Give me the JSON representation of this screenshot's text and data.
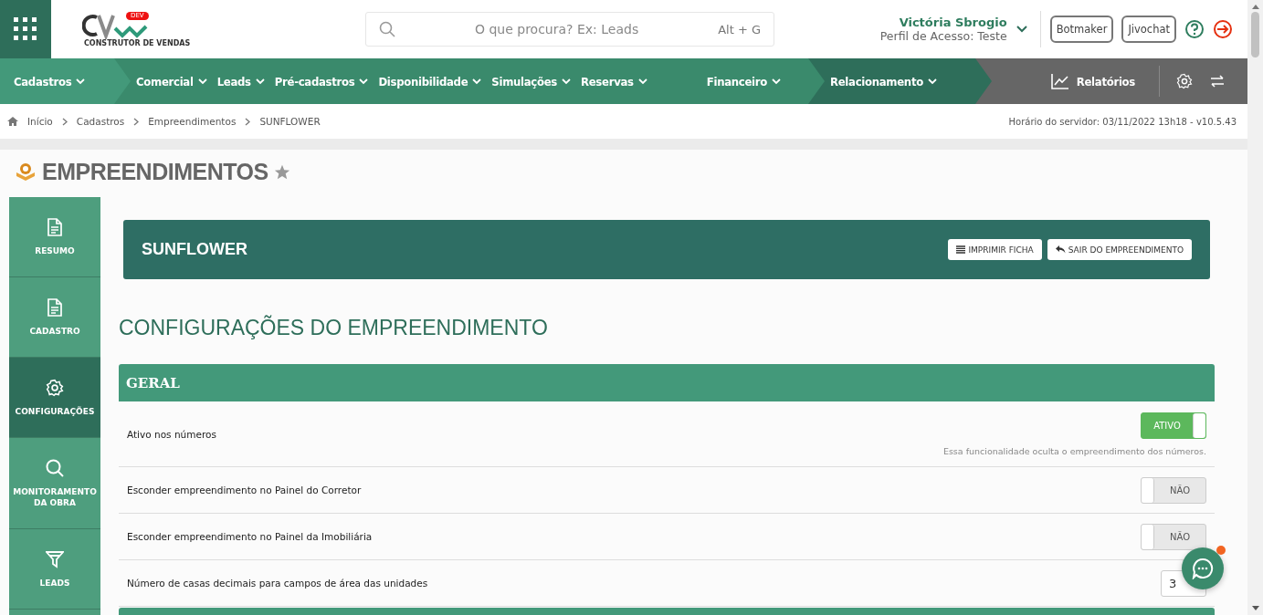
{
  "header": {
    "logo": {
      "text": "CONSTRUTOR DE VENDAS",
      "badge": "DEV"
    },
    "search": {
      "placeholder": "O que procura? Ex: Leads",
      "shortcut": "Alt + G"
    },
    "user": {
      "name": "Victória Sbrogio",
      "profile": "Perfil de Acesso: Teste"
    },
    "buttons": [
      "Botmaker",
      "Jivochat"
    ]
  },
  "nav": {
    "groups": [
      {
        "color": "#43997a",
        "items": [
          "Cadastros"
        ]
      },
      {
        "color": "#3a8a6c",
        "items": [
          "Comercial",
          "Leads",
          "Pré-cadastros",
          "Disponibilidade",
          "Simulações",
          "Reservas",
          "Financeiro"
        ]
      },
      {
        "color": "#2e6e5a",
        "items": [
          "Relacionamento"
        ]
      }
    ],
    "reports": "Relatórios"
  },
  "breadcrumb": [
    "Início",
    "Cadastros",
    "Empreendimentos",
    "SUNFLOWER"
  ],
  "server_time": "Horário do servidor: 03/11/2022 13h18 - v10.5.43",
  "page_title": "EMPREENDIMENTOS",
  "sidebar": {
    "items": [
      {
        "kind": "document",
        "label": "RESUMO",
        "selected": false
      },
      {
        "kind": "document",
        "label": "CADASTRO",
        "selected": false
      },
      {
        "kind": "gear",
        "label": "CONFIGURAÇÕES",
        "selected": true
      },
      {
        "kind": "search",
        "label": "MONITORAMENTO DA OBRA",
        "selected": false
      },
      {
        "kind": "funnel",
        "label": "LEADS",
        "selected": false
      }
    ]
  },
  "project": {
    "name": "SUNFLOWER",
    "buttons": [
      {
        "kind": "print",
        "label": "IMPRIMIR FICHA"
      },
      {
        "kind": "exit",
        "label": "SAIR DO EMPREENDIMENTO"
      }
    ]
  },
  "section_title": "CONFIGURAÇÕES DO EMPREENDIMENTO",
  "panel": {
    "title": "GERAL",
    "rows": [
      {
        "kind": "toggle",
        "label": "Ativo nos números",
        "on": true,
        "value": "ATIVO",
        "hint": "Essa funcionalidade oculta o empreendimento dos números."
      },
      {
        "kind": "toggle",
        "label": "Esconder empreendimento no Painel do Corretor",
        "on": false,
        "value": "NÃO"
      },
      {
        "kind": "toggle",
        "label": "Esconder empreendimento no Painel da Imobiliária",
        "on": false,
        "value": "NÃO"
      },
      {
        "kind": "number",
        "label": "Número de casas decimais para campos de área das unidades",
        "value": "3"
      }
    ]
  }
}
